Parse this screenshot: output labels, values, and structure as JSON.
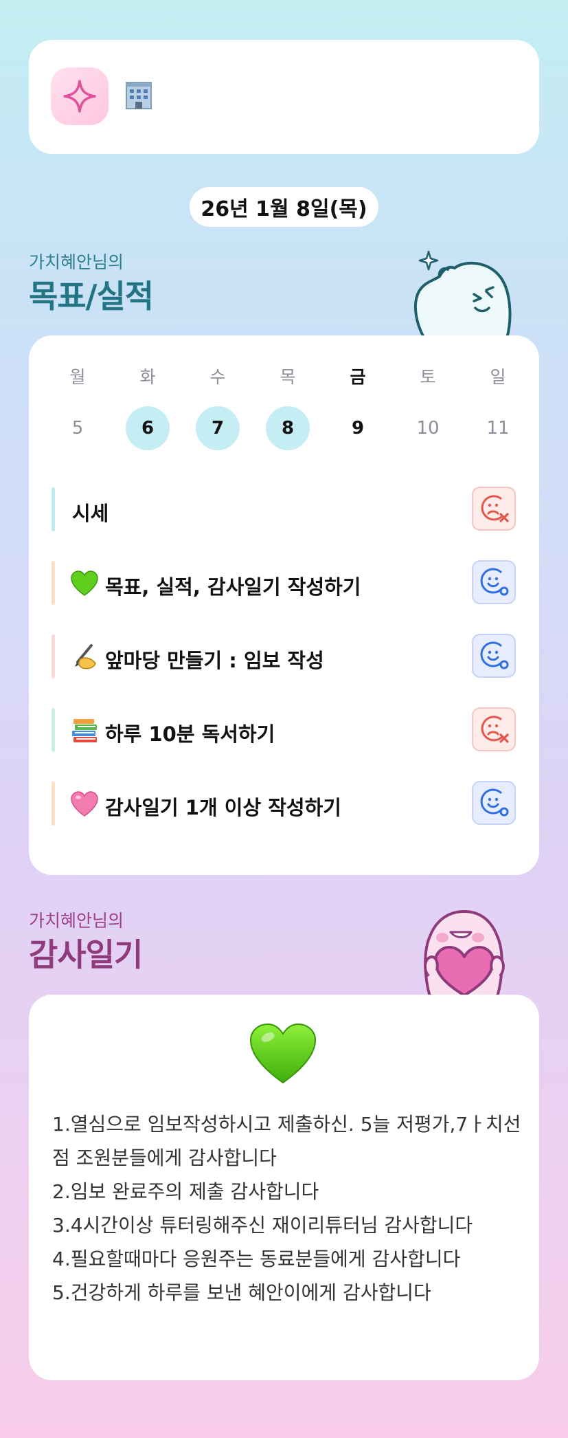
{
  "header": {
    "app_icon": "sparkle-icon",
    "status_icon": "building-icon"
  },
  "date": "26년 1월 8일(목)",
  "goals_section": {
    "owner": "가치혜안님의",
    "title": "목표/실적"
  },
  "week": {
    "days": [
      "월",
      "화",
      "수",
      "목",
      "금",
      "토",
      "일"
    ],
    "dates": [
      "5",
      "6",
      "7",
      "8",
      "9",
      "10",
      "11"
    ]
  },
  "goals": [
    {
      "emoji": "",
      "label": "시세",
      "bar_color": "#bdebef",
      "status": "failed"
    },
    {
      "emoji": "green-heart",
      "label": "목표, 실적, 감사일기 작성하기",
      "bar_color": "#fde0c4",
      "status": "done"
    },
    {
      "emoji": "writing-hand",
      "label": "앞마당 만들기 : 임보 작성",
      "bar_color": "#fcd8d8",
      "status": "done"
    },
    {
      "emoji": "books",
      "label": "하루 10분 독서하기",
      "bar_color": "#c8f0de",
      "status": "failed"
    },
    {
      "emoji": "pink-heart",
      "label": "감사일기 1개 이상 작성하기",
      "bar_color": "#fde0c4",
      "status": "done"
    }
  ],
  "diary_section": {
    "owner": "가치혜안님의",
    "title": "감사일기"
  },
  "diary": {
    "icon": "green-heart",
    "text": "1.열심으로 임보작성하시고 제출하신. 5늘 저평가,7ㅏ치선점 조원분들에게 감사합니다\n2.임보 완료주의 제출 감사합니다\n3.4시간이상 튜터링해주신 재이리튜터님 감사합니다\n4.필요할때마다 응원주는 동료분들에게 감사합니다\n5.건강하게 하루를 보낸 혜안이에게 감사합니다"
  }
}
